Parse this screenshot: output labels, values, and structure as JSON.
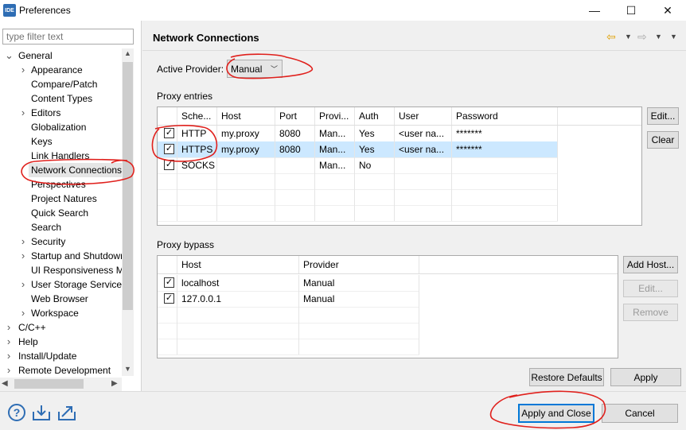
{
  "window": {
    "title": "Preferences",
    "app_icon": "IDE",
    "minimize": "—",
    "maximize": "☐",
    "close": "✕"
  },
  "filter": {
    "placeholder": "type filter text"
  },
  "tree": {
    "general": "General",
    "children": [
      "Appearance",
      "Compare/Patch",
      "Content Types",
      "Editors",
      "Globalization",
      "Keys",
      "Link Handlers",
      "Network Connections",
      "Perspectives",
      "Project Natures",
      "Quick Search",
      "Search",
      "Security",
      "Startup and Shutdown",
      "UI Responsiveness Monitoring",
      "User Storage Service",
      "Web Browser",
      "Workspace"
    ],
    "top_level": [
      "C/C++",
      "Help",
      "Install/Update",
      "Remote Development"
    ]
  },
  "page": {
    "title": "Network Connections"
  },
  "provider": {
    "label": "Active Provider:",
    "value": "Manual"
  },
  "proxy_entries": {
    "label": "Proxy entries",
    "headers": [
      "Sche...",
      "Host",
      "Port",
      "Provi...",
      "Auth",
      "User",
      "Password"
    ],
    "rows": [
      {
        "scheme": "HTTP",
        "host": "my.proxy",
        "port": "8080",
        "provider": "Man...",
        "auth": "Yes",
        "user": "<user na...",
        "password": "*******"
      },
      {
        "scheme": "HTTPS",
        "host": "my.proxy",
        "port": "8080",
        "provider": "Man...",
        "auth": "Yes",
        "user": "<user na...",
        "password": "*******"
      },
      {
        "scheme": "SOCKS",
        "host": "",
        "port": "",
        "provider": "Man...",
        "auth": "No",
        "user": "",
        "password": ""
      }
    ],
    "edit": "Edit...",
    "clear": "Clear"
  },
  "proxy_bypass": {
    "label": "Proxy bypass",
    "headers": [
      "Host",
      "Provider"
    ],
    "rows": [
      {
        "host": "localhost",
        "provider": "Manual"
      },
      {
        "host": "127.0.0.1",
        "provider": "Manual"
      }
    ],
    "add_host": "Add Host...",
    "edit": "Edit...",
    "remove": "Remove"
  },
  "buttons": {
    "restore": "Restore Defaults",
    "apply": "Apply",
    "apply_close": "Apply and Close",
    "cancel": "Cancel"
  },
  "colors": {
    "accent": "#0078d7",
    "selection": "#cce8ff",
    "annotation": "#e0201c"
  }
}
